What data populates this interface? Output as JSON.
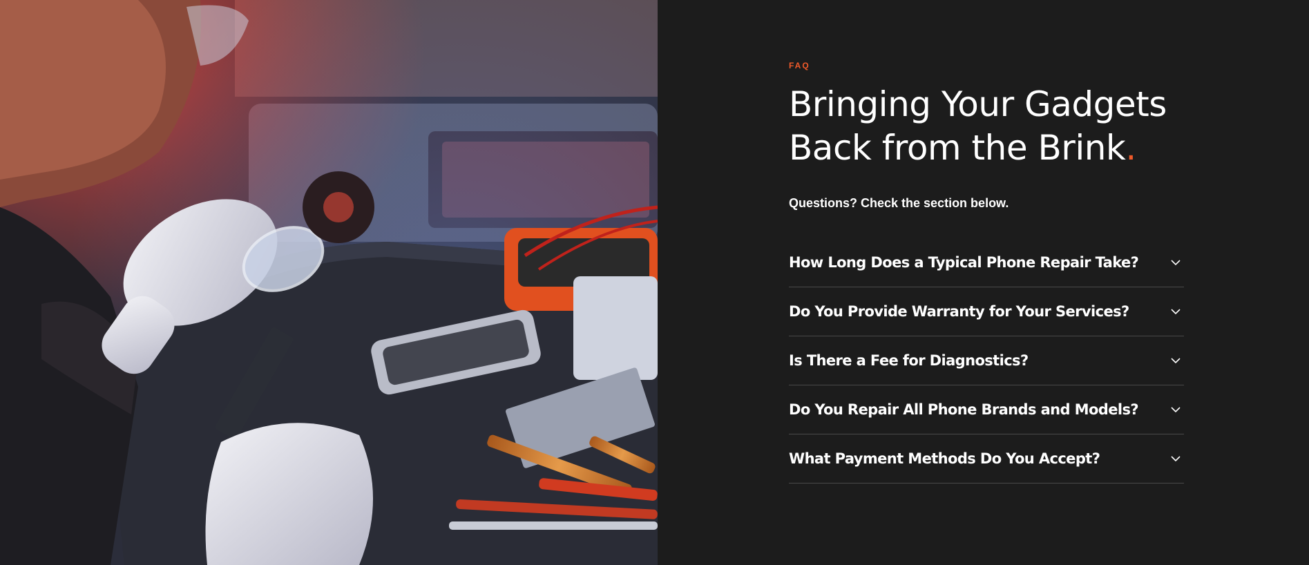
{
  "photo": {
    "alt_semantic": "technician-repairing-phone-photo"
  },
  "faq": {
    "eyebrow": "FAQ",
    "heading_line1": "Bringing Your Gadgets",
    "heading_line2": "Back from the Brink",
    "heading_dot": ".",
    "subtitle": "Questions? Check the section below.",
    "items": [
      {
        "question": "How Long Does a Typical Phone Repair Take?",
        "icon": "chevron-down-icon"
      },
      {
        "question": "Do You Provide Warranty for Your Services?",
        "icon": "chevron-down-icon"
      },
      {
        "question": "Is There a Fee for Diagnostics?",
        "icon": "chevron-down-icon"
      },
      {
        "question": "Do You Repair All Phone Brands and Models?",
        "icon": "chevron-down-icon"
      },
      {
        "question": "What Payment Methods Do You Accept?",
        "icon": "chevron-down-icon"
      }
    ]
  },
  "colors": {
    "background": "#1c1c1c",
    "accent": "#f05a2a",
    "text": "#ffffff",
    "divider": "#4a4a4a"
  }
}
